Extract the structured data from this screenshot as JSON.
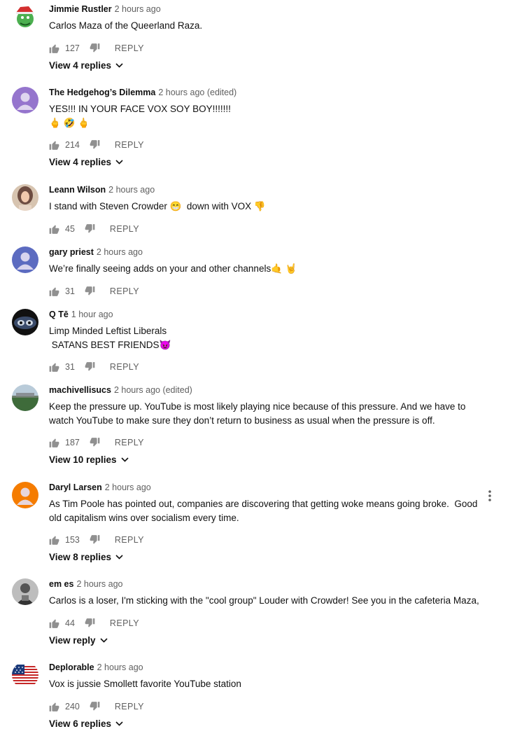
{
  "reply_label": "REPLY",
  "comments": [
    {
      "author": "Jimmie Rustler",
      "time": "2 hours ago",
      "lines": [
        "Carlos Maza of the Queerland Raza."
      ],
      "likes": "127",
      "view_replies": "View 4 replies",
      "avatar": {
        "type": "cartoon",
        "bg": "#ffffff"
      }
    },
    {
      "author": "The Hedgehog’s Dilemma",
      "time": "2 hours ago (edited)",
      "lines": [
        "YES!!! IN YOUR FACE VOX SOY BOY!!!!!!!",
        "🖕 🤣 🖕"
      ],
      "likes": "214",
      "view_replies": "View 4 replies",
      "avatar": {
        "type": "default",
        "bg": "#9575cd"
      }
    },
    {
      "author": "Leann Wilson",
      "time": "2 hours ago",
      "lines": [
        "I stand with Steven Crowder 😁  down with VOX 👎"
      ],
      "likes": "45",
      "view_replies": "",
      "avatar": {
        "type": "photo",
        "bg": "#6d4c41"
      }
    },
    {
      "author": "gary priest",
      "time": "2 hours ago",
      "lines": [
        "We’re finally seeing adds on your and other channels🤙 🤘"
      ],
      "likes": "31",
      "view_replies": "",
      "avatar": {
        "type": "default",
        "bg": "#5c6bc0"
      }
    },
    {
      "author": "Q Tē",
      "time": "1 hour ago",
      "lines": [
        "Limp Minded Leftist Liberals",
        " SATANS BEST FRIENDS😈"
      ],
      "likes": "31",
      "view_replies": "",
      "avatar": {
        "type": "eyes",
        "bg": "#1a1a1a"
      }
    },
    {
      "author": "machivellisucs",
      "time": "2 hours ago (edited)",
      "lines": [
        "Keep the pressure up. YouTube is most likely playing nice because of this pressure. And we have to",
        "watch YouTube to make sure they don’t return to business as usual when the pressure is off."
      ],
      "likes": "187",
      "view_replies": "View 10 replies",
      "avatar": {
        "type": "field",
        "bg": "#9fb5c8"
      }
    },
    {
      "author": "Daryl Larsen",
      "time": "2 hours ago",
      "lines": [
        "As Tim Poole has pointed out, companies are discovering that getting woke means going broke.  Good",
        "old capitalism wins over socialism every time."
      ],
      "likes": "153",
      "view_replies": "View 8 replies",
      "avatar": {
        "type": "default",
        "bg": "#f57c00"
      },
      "menu": true
    },
    {
      "author": "em es",
      "time": "2 hours ago",
      "lines": [
        "Carlos is a loser, I'm sticking with the \"cool group\" Louder with Crowder! See you in the cafeteria Maza,"
      ],
      "likes": "44",
      "view_replies": "View reply",
      "avatar": {
        "type": "bw",
        "bg": "#8a8a8a"
      }
    },
    {
      "author": "Deplorable",
      "time": "2 hours ago",
      "lines": [
        "Vox is jussie Smollett favorite YouTube station"
      ],
      "likes": "240",
      "view_replies": "View 6 replies",
      "avatar": {
        "type": "flag",
        "bg": "#ffffff"
      }
    }
  ]
}
